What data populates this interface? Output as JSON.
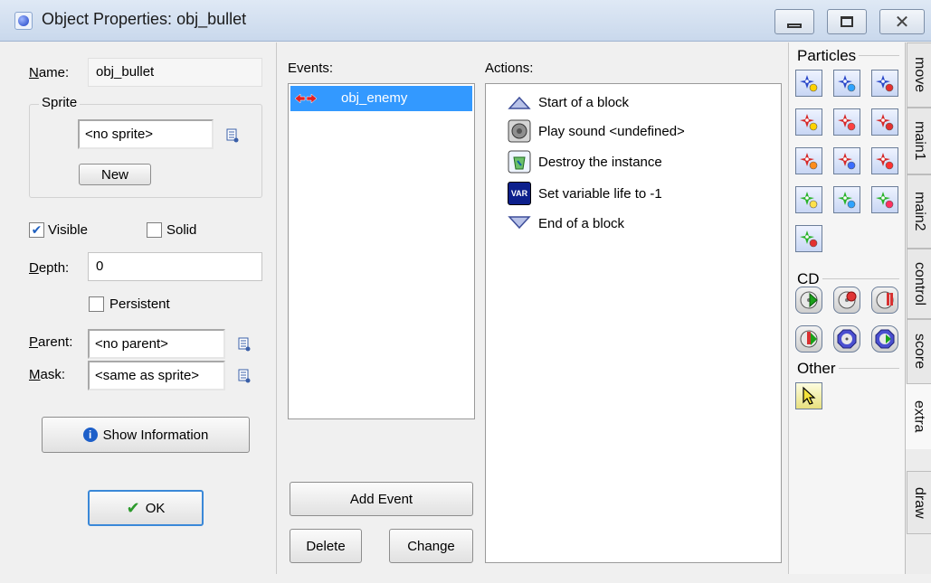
{
  "window": {
    "title": "Object Properties: obj_bullet",
    "controls": {
      "minimize": "▭",
      "maximize": "□",
      "close": "✕"
    }
  },
  "properties": {
    "name_label": "Name:",
    "name_value": "obj_bullet",
    "sprite_group": "Sprite",
    "sprite_value": "<no sprite>",
    "new_button": "New",
    "visible_label": "Visible",
    "visible_checked": true,
    "solid_label": "Solid",
    "solid_checked": false,
    "depth_label": "Depth:",
    "depth_value": "0",
    "persistent_label": "Persistent",
    "persistent_checked": false,
    "parent_label": "Parent:",
    "parent_value": "<no parent>",
    "mask_label": "Mask:",
    "mask_value": "<same as sprite>",
    "show_info_button": "Show Information",
    "ok_button": "OK"
  },
  "events": {
    "header": "Events:",
    "items": [
      {
        "label": "obj_enemy",
        "icon": "collision-icon",
        "selected": true
      }
    ],
    "add_button": "Add Event",
    "delete_button": "Delete",
    "change_button": "Change"
  },
  "actions": {
    "header": "Actions:",
    "items": [
      {
        "label": "Start of a block",
        "icon": "start-block-icon"
      },
      {
        "label": "Play sound <undefined>",
        "icon": "speaker-icon"
      },
      {
        "label": "Destroy the instance",
        "icon": "destroy-instance-icon"
      },
      {
        "label": "Set variable life to -1",
        "icon": "var-icon",
        "icon_text": "VAR"
      },
      {
        "label": "End of a block",
        "icon": "end-block-icon"
      }
    ]
  },
  "library": {
    "sections": [
      {
        "title": "Particles",
        "icons": [
          "create-particle-system-icon",
          "destroy-particle-system-icon",
          "clear-particles-icon",
          "create-particle-type-icon",
          "particle-color-icon",
          "particle-life-icon",
          "particle-speed-icon",
          "particle-gravity-icon",
          "particle-secondary-icon",
          "create-emitter-icon",
          "destroy-emitter-icon",
          "burst-emitter-icon",
          "stream-emitter-icon"
        ]
      },
      {
        "title": "CD",
        "icons": [
          "play-cd-icon",
          "stop-cd-icon",
          "pause-cd-icon",
          "resume-cd-icon",
          "if-cd-exists-icon",
          "if-cd-playing-icon"
        ]
      },
      {
        "title": "Other",
        "icons": [
          "set-cursor-icon"
        ]
      }
    ],
    "tabs": [
      "move",
      "main1",
      "main2",
      "control",
      "score",
      "extra",
      "draw"
    ],
    "active_tab": "extra"
  }
}
